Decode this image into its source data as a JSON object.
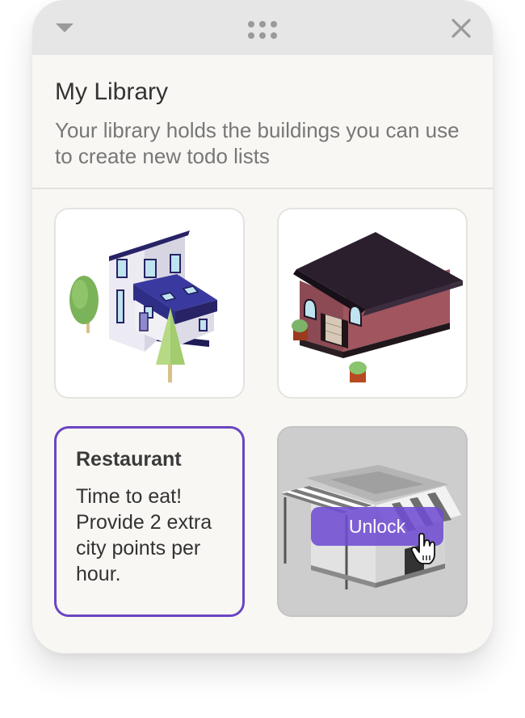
{
  "window": {
    "collapse_icon": "caret-down-icon",
    "drag_icon": "drag-dots-icon",
    "close_icon": "close-icon"
  },
  "library": {
    "title": "My Library",
    "subtitle": "Your library holds the buildings you can use to create new todo lists"
  },
  "cards": [
    {
      "image": "blue-townhouse-illustration",
      "state": "owned"
    },
    {
      "image": "brick-cottage-illustration",
      "state": "owned"
    },
    {
      "title": "Restaurant",
      "description": "Time to eat! Provide 2 extra city points per hour.",
      "state": "selected"
    },
    {
      "image": "restaurant-illustration",
      "state": "locked",
      "unlock_label": "Unlock"
    }
  ],
  "colors": {
    "accent": "#6a45c0",
    "panel_bg": "#f8f7f4",
    "titlebar_bg": "#e6e6e6"
  }
}
